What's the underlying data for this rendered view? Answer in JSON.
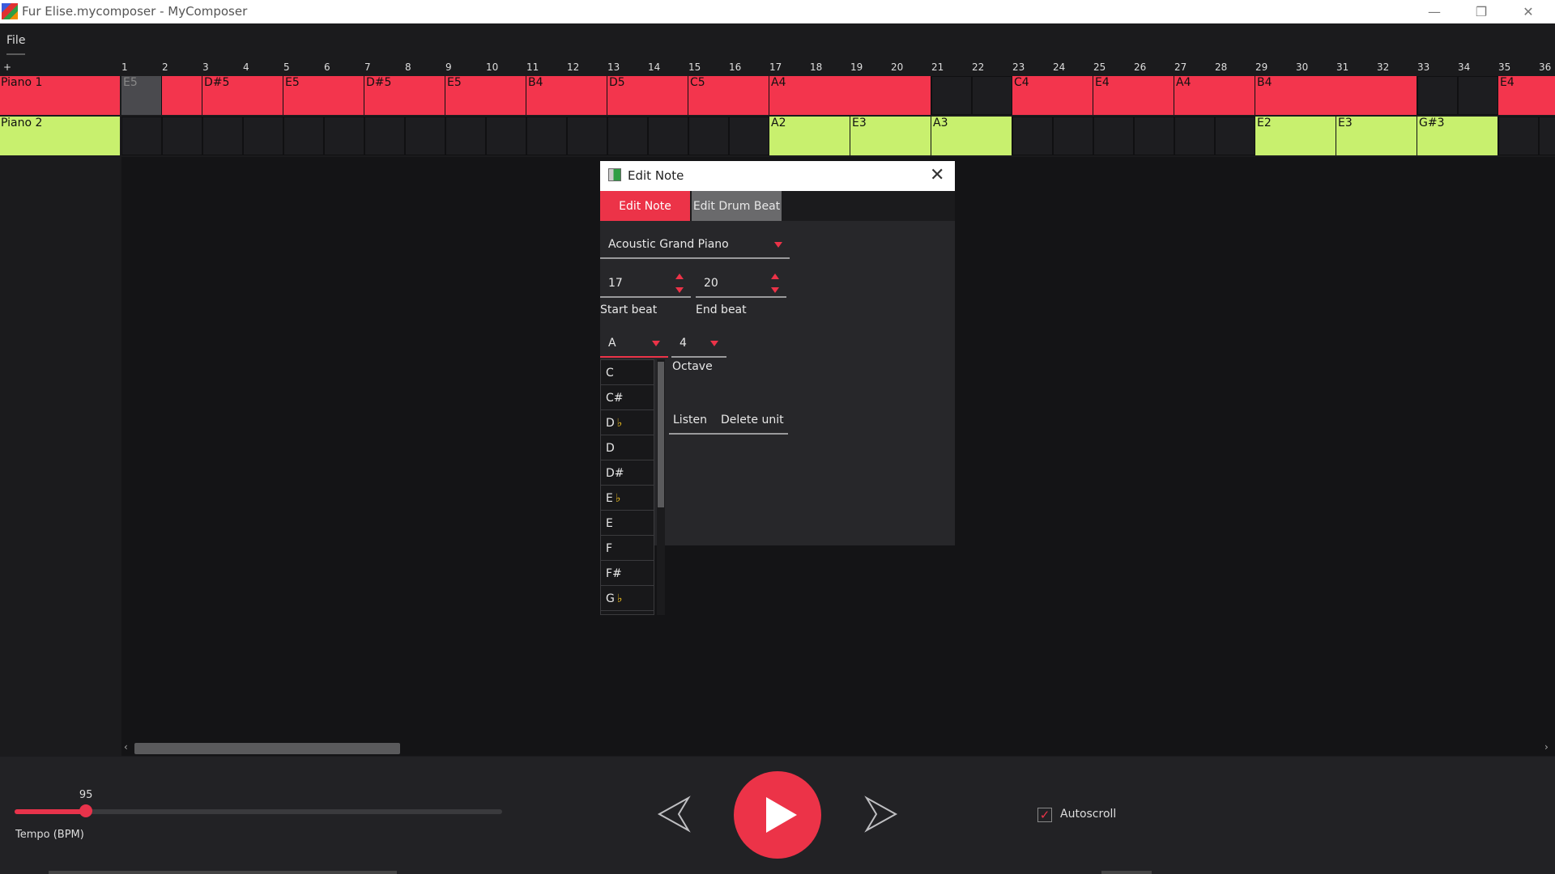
{
  "window": {
    "title": "Fur Elise.mycomposer - MyComposer",
    "minimize_icon": "minimize-icon",
    "maximize_icon": "restore-icon",
    "close_icon": "close-icon"
  },
  "menu": {
    "file": "File"
  },
  "ruler": {
    "plus": "+",
    "beats": [
      "1",
      "2",
      "3",
      "4",
      "5",
      "6",
      "7",
      "8",
      "9",
      "10",
      "11",
      "12",
      "13",
      "14",
      "15",
      "16",
      "17",
      "18",
      "19",
      "20",
      "21",
      "22",
      "23",
      "24",
      "25",
      "26",
      "27",
      "28",
      "29",
      "30",
      "31",
      "32",
      "33",
      "34",
      "35",
      "36"
    ]
  },
  "tracks": [
    {
      "name": "Piano 1",
      "color": "#f3354d",
      "notes": [
        {
          "label": "E5",
          "start": 1,
          "end": 1,
          "selected": true
        },
        {
          "label": "",
          "start": 2,
          "end": 2
        },
        {
          "label": "D#5",
          "start": 3,
          "end": 4
        },
        {
          "label": "E5",
          "start": 5,
          "end": 6
        },
        {
          "label": "D#5",
          "start": 7,
          "end": 8
        },
        {
          "label": "E5",
          "start": 9,
          "end": 10
        },
        {
          "label": "B4",
          "start": 11,
          "end": 12
        },
        {
          "label": "D5",
          "start": 13,
          "end": 14
        },
        {
          "label": "C5",
          "start": 15,
          "end": 16
        },
        {
          "label": "A4",
          "start": 17,
          "end": 20
        },
        {
          "label": "C4",
          "start": 23,
          "end": 24
        },
        {
          "label": "E4",
          "start": 25,
          "end": 26
        },
        {
          "label": "A4",
          "start": 27,
          "end": 28
        },
        {
          "label": "B4",
          "start": 29,
          "end": 32
        },
        {
          "label": "E4",
          "start": 35,
          "end": 36
        }
      ]
    },
    {
      "name": "Piano 2",
      "color": "#c8f06e",
      "notes": [
        {
          "label": "A2",
          "start": 17,
          "end": 18
        },
        {
          "label": "E3",
          "start": 19,
          "end": 20
        },
        {
          "label": "A3",
          "start": 21,
          "end": 22
        },
        {
          "label": "E2",
          "start": 29,
          "end": 30
        },
        {
          "label": "E3",
          "start": 31,
          "end": 32
        },
        {
          "label": "G#3",
          "start": 33,
          "end": 34
        }
      ]
    }
  ],
  "dialog": {
    "title": "Edit Note",
    "tabs": {
      "note": "Edit Note",
      "drum": "Edit Drum Beat"
    },
    "instrument": "Acoustic Grand Piano",
    "start_beat": "17",
    "end_beat": "20",
    "start_label": "Start beat",
    "end_label": "End beat",
    "note": "A",
    "octave": "4",
    "octave_label": "Octave",
    "listen": "Listen",
    "delete": "Delete unit",
    "note_options": [
      {
        "text": "C",
        "flat": ""
      },
      {
        "text": "C#",
        "flat": ""
      },
      {
        "text": "D",
        "flat": "♭"
      },
      {
        "text": "D",
        "flat": ""
      },
      {
        "text": "D#",
        "flat": ""
      },
      {
        "text": "E",
        "flat": "♭"
      },
      {
        "text": "E",
        "flat": ""
      },
      {
        "text": "F",
        "flat": ""
      },
      {
        "text": "F#",
        "flat": ""
      },
      {
        "text": "G",
        "flat": "♭"
      }
    ]
  },
  "transport": {
    "tempo_value": "95",
    "tempo_label": "Tempo (BPM)",
    "tempo_fraction": 0.146,
    "autoscroll_label": "Autoscroll",
    "autoscroll_checked": true,
    "prev_icon": "previous-icon",
    "play_icon": "play-icon",
    "next_icon": "next-icon"
  },
  "colors": {
    "accent": "#ec3348",
    "piano1": "#f3354d",
    "piano2": "#c8f06e"
  }
}
